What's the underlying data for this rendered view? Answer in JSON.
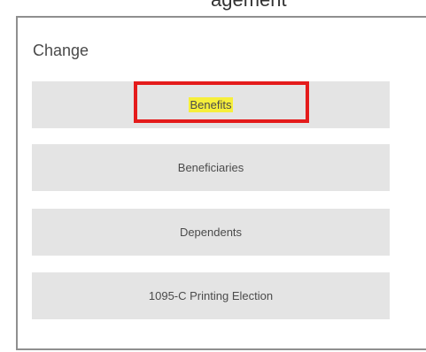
{
  "top_fragment": "agement",
  "panel": {
    "title": "Change",
    "buttons": [
      {
        "label": "Benefits",
        "highlighted": true
      },
      {
        "label": "Beneficiaries",
        "highlighted": false
      },
      {
        "label": "Dependents",
        "highlighted": false
      },
      {
        "label": "1095-C Printing Election",
        "highlighted": false
      }
    ]
  },
  "colors": {
    "button_bg": "#e4e4e4",
    "highlight": "#f6ef3b",
    "annotation": "#e41b1b"
  }
}
